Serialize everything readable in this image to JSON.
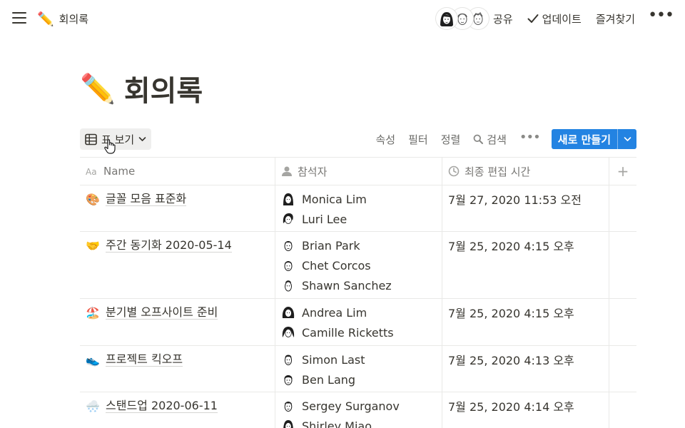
{
  "topbar": {
    "page_emoji": "✏️",
    "page_name": "회의록",
    "share_label": "공유",
    "updates_label": "업데이트",
    "favorite_label": "즐겨찾기",
    "more_label": "•••"
  },
  "page": {
    "emoji": "✏️",
    "title": "회의록"
  },
  "toolbar": {
    "view_label": "표 보기",
    "properties_label": "속성",
    "filter_label": "필터",
    "sort_label": "정렬",
    "search_label": "검색",
    "more_label": "•••",
    "new_label": "새로 만들기"
  },
  "table": {
    "columns": {
      "name": "Name",
      "attendees": "참석자",
      "edited": "최종 편집 시간",
      "add": "+"
    },
    "rows": [
      {
        "emoji": "🎨",
        "name": "글꼴 모음 표준화",
        "attendees": [
          "Monica Lim",
          "Luri Lee"
        ],
        "edited": "7월 27, 2020 11:53 오전"
      },
      {
        "emoji": "🤝",
        "name": "주간 동기화 2020-05-14",
        "attendees": [
          "Brian Park",
          "Chet Corcos",
          "Shawn Sanchez"
        ],
        "edited": "7월 25, 2020 4:15 오후"
      },
      {
        "emoji": "🏖️",
        "name": "분기별 오프사이트 준비",
        "attendees": [
          "Andrea Lim",
          "Camille Ricketts"
        ],
        "edited": "7월 25, 2020 4:15 오후"
      },
      {
        "emoji": "👟",
        "name": "프로젝트 킥오프",
        "attendees": [
          "Simon Last",
          "Ben Lang"
        ],
        "edited": "7월 25, 2020 4:13 오후"
      },
      {
        "emoji": "🌨️",
        "name": "스탠드업 2020-06-11",
        "attendees": [
          "Sergey Surganov",
          "Shirley Miao"
        ],
        "edited": "7월 25, 2020 4:14 오후"
      }
    ]
  },
  "colors": {
    "accent": "#2383e2",
    "text": "#37352f",
    "muted": "#787774",
    "divider": "#e9e9e7"
  }
}
